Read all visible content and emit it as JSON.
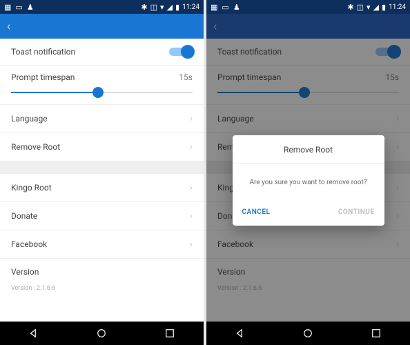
{
  "statusbar": {
    "time": "11:24"
  },
  "settings": {
    "toast_label": "Toast notification",
    "toast_on": true,
    "prompt_label": "Prompt timespan",
    "prompt_value": "15s",
    "language_label": "Language",
    "remove_root_label": "Remove Root",
    "kingo_label": "Kingo Root",
    "donate_label": "Donate",
    "facebook_label": "Facebook",
    "version_label": "Version",
    "version_value": "Version : 2.1.6.6"
  },
  "dialog": {
    "title": "Remove Root",
    "message": "Are you sure you want to remove root?",
    "cancel": "CANCEL",
    "continue": "CONTINUE"
  }
}
